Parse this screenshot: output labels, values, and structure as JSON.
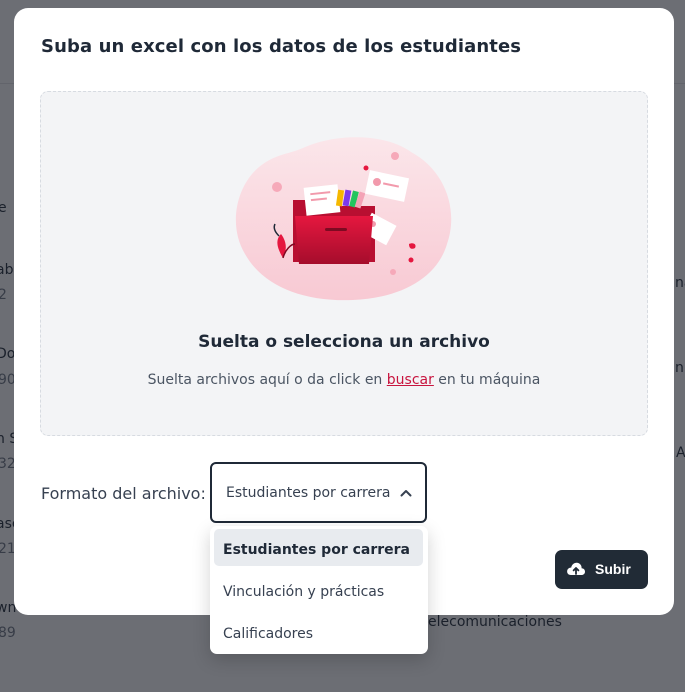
{
  "modal": {
    "title": "Suba un excel con los datos de los estudiantes",
    "dropzone": {
      "title": "Suelta o selecciona un archivo",
      "subtitle_before": "Suelta archivos aquí o da click en ",
      "link": "buscar",
      "subtitle_after": " en tu máquina"
    },
    "format": {
      "label": "Formato del archivo:",
      "selected": "Estudiantes por carrera",
      "options": [
        "Estudiantes por carrera",
        "Vinculación y prácticas",
        "Calificadores"
      ]
    },
    "upload_button": "Subir"
  },
  "background": {
    "fragments": [
      "e",
      "ab",
      "2",
      "Do",
      "90",
      "n S",
      "32",
      "asc",
      "21",
      "wn",
      "89",
      "na",
      "n",
      "A",
      "elecomunicaciones"
    ]
  },
  "colors": {
    "accent": "#c8153f",
    "button_dark": "#212b36",
    "dropzone_bg": "#f3f4f6",
    "overlay": "#2b2d35"
  },
  "icons": {
    "select_chevron": "chevron-up-icon",
    "upload": "cloud-upload-icon",
    "illustration": "folder-files-illustration"
  }
}
